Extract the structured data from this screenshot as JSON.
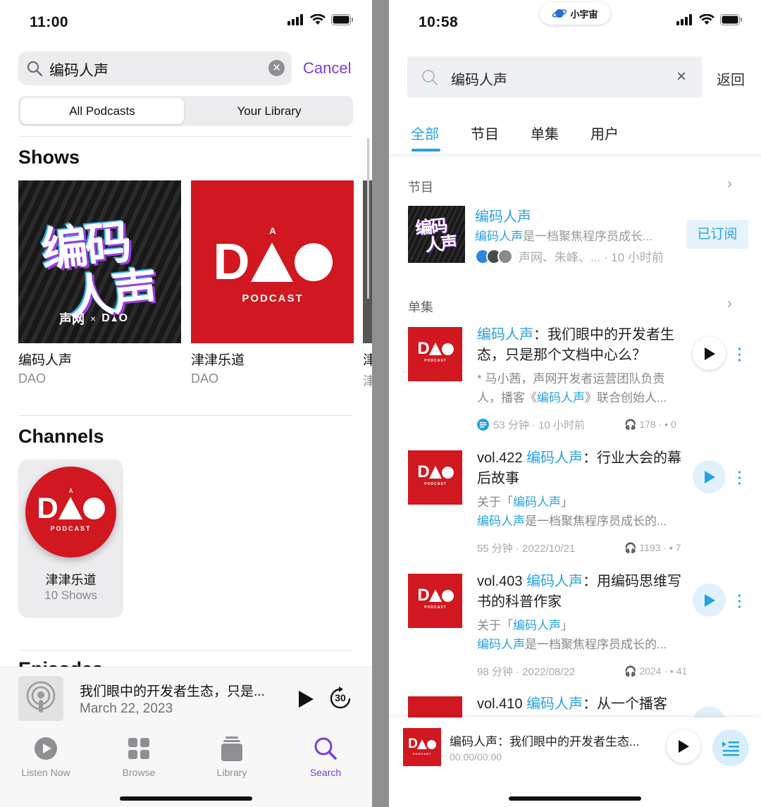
{
  "left": {
    "status": {
      "time": "11:00"
    },
    "search": {
      "query": "编码人声",
      "cancel_label": "Cancel"
    },
    "segment": {
      "options": [
        "All Podcasts",
        "Your Library"
      ],
      "selected": "All Podcasts"
    },
    "shows_title": "Shows",
    "shows": [
      {
        "name": "编码人声",
        "author": "DAO"
      },
      {
        "name": "津津乐道",
        "author": "DAO"
      },
      {
        "name": "津",
        "author": "津"
      }
    ],
    "channels_title": "Channels",
    "channels": [
      {
        "name": "津津乐道",
        "count": "10 Shows"
      }
    ],
    "next_section_peek": "Episodes",
    "mini_player": {
      "title": "我们眼中的开发者生态，只是...",
      "date": "March 22, 2023",
      "skip_label": "30"
    },
    "tabs": [
      {
        "label": "Listen Now",
        "icon": "play-circle-icon"
      },
      {
        "label": "Browse",
        "icon": "grid-icon"
      },
      {
        "label": "Library",
        "icon": "stack-icon"
      },
      {
        "label": "Search",
        "icon": "search-icon",
        "active": true
      }
    ],
    "accent": "#7a3dd9"
  },
  "art": {
    "code_line1": "编码",
    "code_line2": "人声",
    "code_brand": "声网",
    "code_x": "×",
    "dao_a": "A",
    "dao_word": "D  O",
    "dao_pod": "PODCAST"
  },
  "right": {
    "status": {
      "time": "10:58"
    },
    "island_label": "小宇宙",
    "search": {
      "query": "编码人声",
      "clear": "×",
      "back_label": "返回"
    },
    "tabs": [
      "全部",
      "节目",
      "单集",
      "用户"
    ],
    "active_tab": "全部",
    "shows_section": "节目",
    "show": {
      "title": "编码人声",
      "desc_hl": "编码人声",
      "desc_rest": "是一档聚焦程序员成长...",
      "meta": "声网、朱峰、... · 10 小时前",
      "subscribed_label": "已订阅"
    },
    "episodes_section": "单集",
    "episodes": [
      {
        "prefix": "",
        "hl": "编码人声",
        "rest": "：我们眼中的开发者生态，只是那个文档中心么？",
        "desc1_pre": "* 马小茜，声网开发者运营团队负责",
        "desc2_pre": "人，播客《",
        "desc2_hl": "编码人声",
        "desc2_post": "》联合创始人...",
        "meta": "53 分钟 · 10 小时前",
        "plays": "178",
        "comments": "0"
      },
      {
        "prefix": "vol.422 ",
        "hl": "编码人声",
        "rest": "：行业大会的幕后故事",
        "desc1_pre": "关于「",
        "desc1_hl": "编码人声",
        "desc1_post": "」",
        "desc2_hl": "编码人声",
        "desc2_post": "是一档聚焦程序员成长的...",
        "meta": "55 分钟 · 2022/10/21",
        "plays": "1193",
        "comments": "7"
      },
      {
        "prefix": "vol.403 ",
        "hl": "编码人声",
        "rest": "：用编码思维写书的科普作家",
        "desc1_pre": "关于「",
        "desc1_hl": "编码人声",
        "desc1_post": "」",
        "desc2_hl": "编码人声",
        "desc2_post": "是一档聚焦程序员成长的...",
        "meta": "98 分钟 · 2022/08/22",
        "plays": "2024",
        "comments": "41"
      },
      {
        "prefix": "vol.410 ",
        "hl": "编码人声",
        "rest": "：从一个播客"
      }
    ],
    "player": {
      "title": "编码人声：我们眼中的开发者生态...",
      "time": "00:00/00:00"
    },
    "accent": "#27a2e0"
  }
}
